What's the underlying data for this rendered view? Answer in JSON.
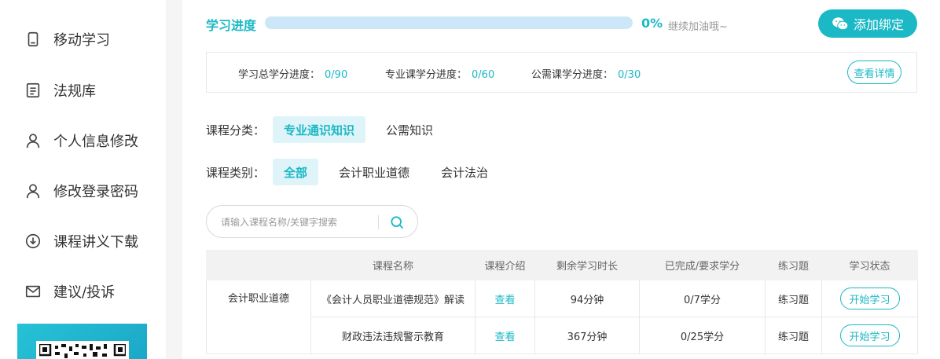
{
  "sidebar": {
    "items": [
      {
        "label": "移动学习",
        "icon": "mobile-icon"
      },
      {
        "label": "法规库",
        "icon": "document-icon"
      },
      {
        "label": "个人信息修改",
        "icon": "user-icon"
      },
      {
        "label": "修改登录密码",
        "icon": "user-lock-icon"
      },
      {
        "label": "课程讲义下载",
        "icon": "download-icon"
      },
      {
        "label": "建议/投诉",
        "icon": "mail-icon"
      }
    ]
  },
  "progress": {
    "label": "学习进度",
    "percent_text": "0%",
    "fraction": 0,
    "hint": "继续加油哦~",
    "bind_button": "添加绑定"
  },
  "credits": {
    "total_label": "学习总学分进度：",
    "total_value": "0/90",
    "major_label": "专业课学分进度：",
    "major_value": "0/60",
    "public_label": "公需课学分进度：",
    "public_value": "0/30",
    "detail_button": "查看详情"
  },
  "filters": {
    "category_label": "课程分类：",
    "categories": [
      "专业通识知识",
      "公需知识"
    ],
    "type_label": "课程类别：",
    "types": [
      "全部",
      "会计职业道德",
      "会计法治"
    ]
  },
  "search": {
    "placeholder": "请输入课程名称/关键字搜索"
  },
  "table": {
    "headers": [
      "",
      "课程名称",
      "课程介绍",
      "剩余学习时长",
      "已完成/要求学分",
      "练习题",
      "学习状态"
    ],
    "group": "会计职业道德",
    "rows": [
      {
        "name": "《会计人员职业道德规范》解读",
        "intro": "查看",
        "remaining": "94分钟",
        "credits": "0/7学分",
        "exercise": "练习题",
        "status": "开始学习"
      },
      {
        "name": "财政违法违规警示教育",
        "intro": "查看",
        "remaining": "367分钟",
        "credits": "0/25学分",
        "exercise": "练习题",
        "status": "开始学习"
      }
    ]
  },
  "colors": {
    "accent": "#1bb8c5",
    "track": "#cce7f7",
    "chip_active_bg": "#dff4f9"
  }
}
